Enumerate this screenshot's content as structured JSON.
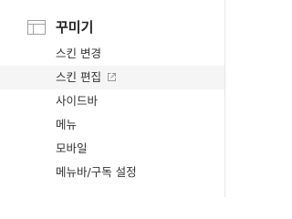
{
  "section": {
    "title": "꾸미기",
    "icon": "layout-icon"
  },
  "menu": {
    "items": [
      {
        "label": "스킨 변경",
        "active": false,
        "external": false
      },
      {
        "label": "스킨 편집",
        "active": true,
        "external": true,
        "icon": "external-link-icon"
      },
      {
        "label": "사이드바",
        "active": false,
        "external": false
      },
      {
        "label": "메뉴",
        "active": false,
        "external": false
      },
      {
        "label": "모바일",
        "active": false,
        "external": false
      },
      {
        "label": "메뉴바/구독 설정",
        "active": false,
        "external": false
      }
    ]
  },
  "colors": {
    "text": "#333333",
    "title": "#222222",
    "active_bg": "#f5f5f5",
    "icon": "#999999",
    "border": "#e6e6e6"
  }
}
